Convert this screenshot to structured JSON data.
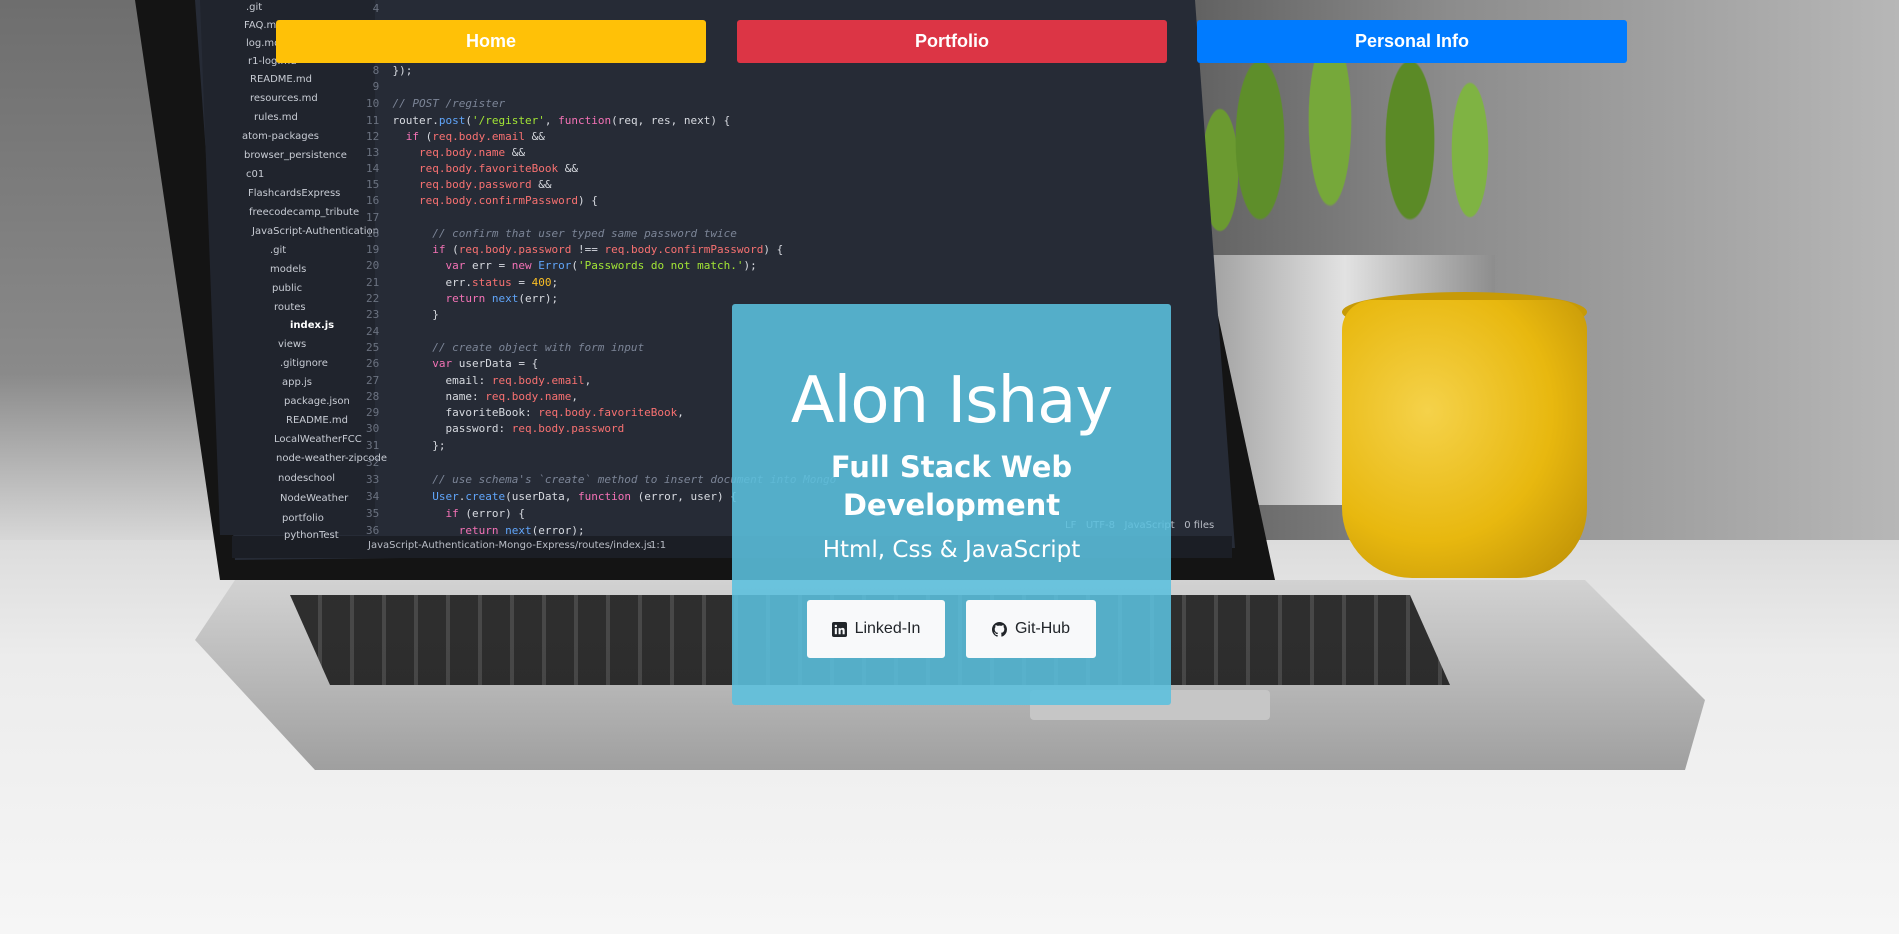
{
  "nav": {
    "home_label": "Home",
    "portfolio_label": "Portfolio",
    "personal_info_label": "Personal Info"
  },
  "hero": {
    "name": "Alon Ishay",
    "role": "Full Stack Web Development",
    "skills": "Html, Css & JavaScript",
    "linkedin_label": "Linked-In",
    "github_label": "Git-Hub",
    "linkedin_icon": "linkedin-icon",
    "github_icon": "github-icon"
  },
  "background": {
    "editor": {
      "file_tree": [
        ".git",
        "FAQ.md",
        "log.md",
        "r1-log.md",
        "README.md",
        "resources.md",
        "rules.md",
        "atom-packages",
        "browser_persistence",
        "c01",
        "FlashcardsExpress",
        "freecodecamp_tribute",
        "JavaScript-Authentication",
        ".git",
        "models",
        "public",
        "routes",
        "index.js",
        "views",
        ".gitignore",
        "app.js",
        "package.json",
        "README.md",
        "LocalWeatherFCC",
        "node-weather-zipcode",
        "nodeschool",
        "NodeWeather",
        "portfolio",
        "pythonTest"
      ],
      "status_path": "JavaScript-Authentication-Mongo-Express/routes/index.js",
      "status_position": "1:1",
      "status_right": "LF   UTF-8   JavaScript   0 files"
    }
  },
  "colors": {
    "home": "#ffc107",
    "portfolio": "#dc3545",
    "personal_info": "#007bff",
    "hero_card": "rgba(91, 192, 222, 0.88)",
    "social_button_bg": "#f8f9fa",
    "nav_text_home": "#ffffff",
    "nav_text": "#ffffff"
  }
}
